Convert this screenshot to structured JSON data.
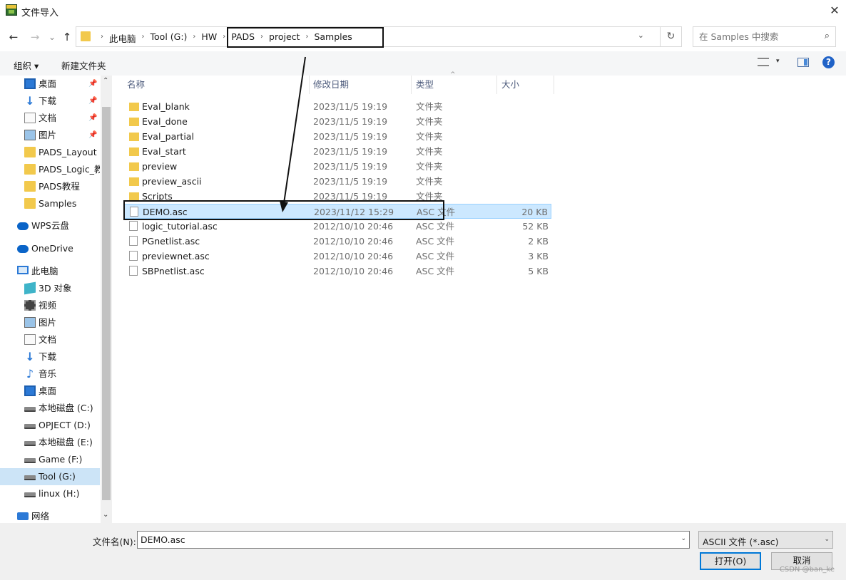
{
  "window": {
    "title": "文件导入",
    "close_label": "✕"
  },
  "nav_buttons": {
    "back": "←",
    "forward": "→",
    "recent": "⌄",
    "up": "↑"
  },
  "address": {
    "crumbs": [
      "此电脑",
      "Tool (G:)",
      "HW",
      "PADS",
      "project",
      "Samples"
    ],
    "separator": "›",
    "dropdown": "⌄",
    "refresh": "↻"
  },
  "search": {
    "placeholder": "在 Samples 中搜索",
    "icon": "⌕"
  },
  "toolbar": {
    "organize": "组织 ▾",
    "new_folder": "新建文件夹",
    "help": "?",
    "view_dropdown": "▾"
  },
  "nav_pane": {
    "items": [
      {
        "label": "桌面",
        "icon": "desktop",
        "pinned": true
      },
      {
        "label": "下载",
        "icon": "download",
        "pinned": true
      },
      {
        "label": "文档",
        "icon": "document",
        "pinned": true
      },
      {
        "label": "图片",
        "icon": "picture",
        "pinned": true
      },
      {
        "label": "PADS_Layout 教",
        "icon": "folder",
        "pinned": false
      },
      {
        "label": "PADS_Logic_教",
        "icon": "folder",
        "pinned": false
      },
      {
        "label": "PADS教程",
        "icon": "folder",
        "pinned": false
      },
      {
        "label": "Samples",
        "icon": "folder",
        "pinned": false
      },
      {
        "label": "WPS云盘",
        "icon": "cloud",
        "pinned": false
      },
      {
        "label": "OneDrive",
        "icon": "cloud",
        "pinned": false
      },
      {
        "label": "此电脑",
        "icon": "pc",
        "pinned": false
      },
      {
        "label": "3D 对象",
        "icon": "3d",
        "pinned": false
      },
      {
        "label": "视频",
        "icon": "video",
        "pinned": false
      },
      {
        "label": "图片",
        "icon": "picture",
        "pinned": false
      },
      {
        "label": "文档",
        "icon": "document",
        "pinned": false
      },
      {
        "label": "下载",
        "icon": "download",
        "pinned": false
      },
      {
        "label": "音乐",
        "icon": "music",
        "pinned": false
      },
      {
        "label": "桌面",
        "icon": "desktop",
        "pinned": false
      },
      {
        "label": "本地磁盘 (C:)",
        "icon": "drive",
        "pinned": false
      },
      {
        "label": "OPJECT (D:)",
        "icon": "drive",
        "pinned": false
      },
      {
        "label": "本地磁盘 (E:)",
        "icon": "drive",
        "pinned": false
      },
      {
        "label": "Game (F:)",
        "icon": "drive",
        "pinned": false
      },
      {
        "label": "Tool (G:)",
        "icon": "drive",
        "pinned": false,
        "selected": true
      },
      {
        "label": "linux (H:)",
        "icon": "drive",
        "pinned": false
      },
      {
        "label": "网络",
        "icon": "network",
        "pinned": false
      }
    ],
    "pin_glyph": "📌"
  },
  "columns": {
    "name": "名称",
    "date": "修改日期",
    "type": "类型",
    "size": "大小"
  },
  "files": [
    {
      "name": "Eval_blank",
      "date": "2023/11/5 19:19",
      "type": "文件夹",
      "size": "",
      "kind": "folder"
    },
    {
      "name": "Eval_done",
      "date": "2023/11/5 19:19",
      "type": "文件夹",
      "size": "",
      "kind": "folder"
    },
    {
      "name": "Eval_partial",
      "date": "2023/11/5 19:19",
      "type": "文件夹",
      "size": "",
      "kind": "folder"
    },
    {
      "name": "Eval_start",
      "date": "2023/11/5 19:19",
      "type": "文件夹",
      "size": "",
      "kind": "folder"
    },
    {
      "name": "preview",
      "date": "2023/11/5 19:19",
      "type": "文件夹",
      "size": "",
      "kind": "folder"
    },
    {
      "name": "preview_ascii",
      "date": "2023/11/5 19:19",
      "type": "文件夹",
      "size": "",
      "kind": "folder"
    },
    {
      "name": "Scripts",
      "date": "2023/11/5 19:19",
      "type": "文件夹",
      "size": "",
      "kind": "folder"
    },
    {
      "name": "DEMO.asc",
      "date": "2023/11/12 15:29",
      "type": "ASC 文件",
      "size": "20 KB",
      "kind": "file",
      "selected": true
    },
    {
      "name": "logic_tutorial.asc",
      "date": "2012/10/10 20:46",
      "type": "ASC 文件",
      "size": "52 KB",
      "kind": "file"
    },
    {
      "name": "PGnetlist.asc",
      "date": "2012/10/10 20:46",
      "type": "ASC 文件",
      "size": "2 KB",
      "kind": "file"
    },
    {
      "name": "previewnet.asc",
      "date": "2012/10/10 20:46",
      "type": "ASC 文件",
      "size": "3 KB",
      "kind": "file"
    },
    {
      "name": "SBPnetlist.asc",
      "date": "2012/10/10 20:46",
      "type": "ASC 文件",
      "size": "5 KB",
      "kind": "file"
    }
  ],
  "bottom": {
    "filename_label": "文件名(N):",
    "filename_value": "DEMO.asc",
    "filetype_value": "ASCII 文件 (*.asc)",
    "open_button": "打开(O)",
    "cancel_button": "取消",
    "watermark": "CSDN @ban_ke"
  }
}
